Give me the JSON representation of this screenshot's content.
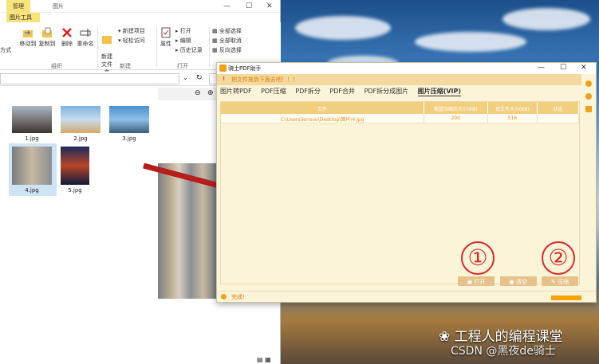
{
  "explorer": {
    "ribbon_tabs": [
      "管理",
      "图片"
    ],
    "subtab": "图片工具",
    "left_partial": "方式",
    "ribbon": {
      "move_to": "移动到",
      "copy_to": "复制到",
      "delete": "删除",
      "rename": "重命名",
      "new_folder": "新建\n文件夹",
      "new_item": "新建项目",
      "easy_access": "轻松访问",
      "properties": "属性",
      "open": "打开",
      "edit": "编辑",
      "history": "历史记录",
      "select_all": "全部选择",
      "select_none": "全部取消",
      "invert": "反向选择",
      "group_organize": "组织",
      "group_new": "新建",
      "group_open": "打开"
    },
    "files": [
      {
        "name": "1.jpg"
      },
      {
        "name": "2.jpg"
      },
      {
        "name": "3.jpg"
      },
      {
        "name": "4.jpg"
      },
      {
        "name": "5.jpg"
      }
    ]
  },
  "pdf": {
    "title": "骑士PDF助手",
    "warning": "把文件拖到下面去吧！！！",
    "tabs": [
      "图片转PDF",
      "PDF压缩",
      "PDF拆分",
      "PDF合并",
      "PDF拆分成图片",
      "图片压缩(VIP)"
    ],
    "columns": [
      "文件",
      "期望压缩后大小(KB)",
      "现文件大小(KB)",
      "状态"
    ],
    "row": {
      "file": "C:\\Users\\lenovo\\Desktop\\图片\\4.jpg",
      "target": "200",
      "size": "516",
      "status": ""
    },
    "open_btn": "打开",
    "clear_btn": "清空",
    "compress_btn": "压缩",
    "status": "完成!"
  },
  "annotations": {
    "one": "①",
    "two": "②"
  },
  "watermark": {
    "line1": "工程人的编程课堂",
    "line2": "CSDN @黑夜de骑士"
  },
  "colors": {
    "accent": "#f5a300",
    "arrow": "#b81d1d",
    "highlight": "#d62b2b"
  }
}
